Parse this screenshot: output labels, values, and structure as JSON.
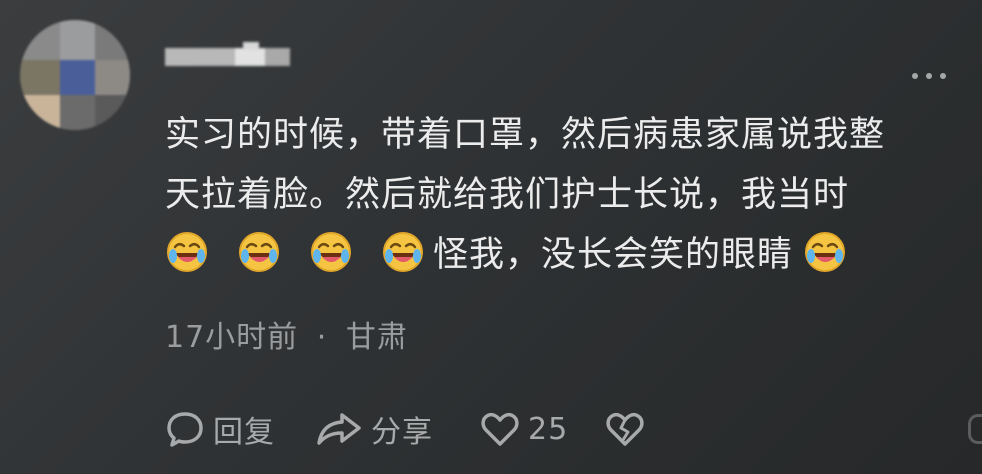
{
  "comment": {
    "line1": "实习的时候，带着口罩，然后病患家属说我整",
    "line2": "天拉着脸。然后就给我们护士长说，我当时",
    "line3_text": "怪我，没长会笑的眼睛",
    "emoji_icon": "rolling-on-the-floor-laughing"
  },
  "meta": {
    "time": "17小时前",
    "separator": "·",
    "location": "甘肃"
  },
  "actions": {
    "reply_label": "回复",
    "share_label": "分享",
    "like_count": "25"
  },
  "colors": {
    "background": "#2f3234",
    "text": "#ececec",
    "meta": "#9a9c9e",
    "icon": "#a7a9ab",
    "emoji_face": "#f6c443"
  }
}
